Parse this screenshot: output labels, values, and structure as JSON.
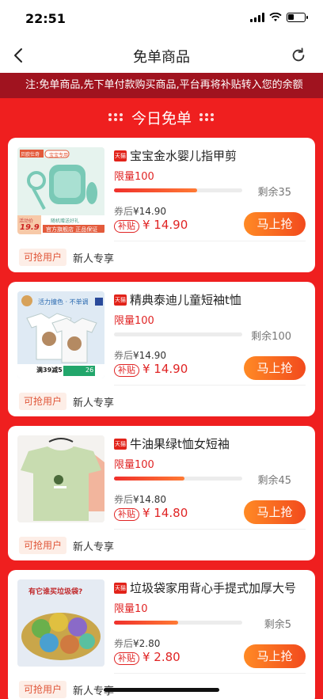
{
  "status": {
    "time": "22:51"
  },
  "nav": {
    "title": "免单商品"
  },
  "notice": {
    "text": "注:免单商品,先下单付款购买商品,平台再将补贴转入您的余额"
  },
  "section": {
    "title": "今日免单"
  },
  "colors": {
    "accent": "#ef1f1f",
    "notice_bg": "#a0131f",
    "button": "#ff6a24"
  },
  "products": [
    {
      "title": "宝宝金水婴儿指甲剪",
      "badge": "天猫",
      "limit": "限量100",
      "progress": 0.65,
      "remain": "剩余35",
      "coupon_label": "券后",
      "coupon_price": "¥14.90",
      "subsidy_label": "补贴",
      "subsidy_price": "¥ 14.90",
      "button": "马上抢",
      "tag": "可抢用户",
      "newbie": "新人专享",
      "image": {
        "shop": "贝欧仕奇",
        "slogan": "宝宝专用",
        "strip": "官方旗舰店 正品保证",
        "promo": "活动价",
        "price": "19.9",
        "note": "随机赠送好礼"
      }
    },
    {
      "title": "精典泰迪儿童短袖t恤",
      "badge": "天猫",
      "limit": "限量100",
      "progress": 0.0,
      "remain": "剩余100",
      "coupon_label": "券后",
      "coupon_price": "¥14.90",
      "subsidy_label": "补贴",
      "subsidy_price": "¥ 14.90",
      "button": "马上抢",
      "tag": "可抢用户",
      "newbie": "新人专享",
      "image": {
        "headline": "活力撞色 · 不单调",
        "promo": "满39减5",
        "count": "26"
      }
    },
    {
      "title": "牛油果绿t恤女短袖",
      "badge": "天猫",
      "limit": "限量100",
      "progress": 0.55,
      "remain": "剩余45",
      "coupon_label": "券后",
      "coupon_price": "¥14.80",
      "subsidy_label": "补贴",
      "subsidy_price": "¥ 14.80",
      "button": "马上抢",
      "tag": "可抢用户",
      "newbie": "新人专享",
      "image": {}
    },
    {
      "title": "垃圾袋家用背心手提式加厚大号",
      "badge": "天猫",
      "limit": "限量10",
      "progress": 0.5,
      "remain": "剩余5",
      "coupon_label": "券后",
      "coupon_price": "¥2.80",
      "subsidy_label": "补贴",
      "subsidy_price": "¥ 2.80",
      "button": "马上抢",
      "tag": "可抢用户",
      "newbie": "新人专享",
      "image": {
        "headline": "有它谁买垃圾袋?"
      }
    }
  ]
}
